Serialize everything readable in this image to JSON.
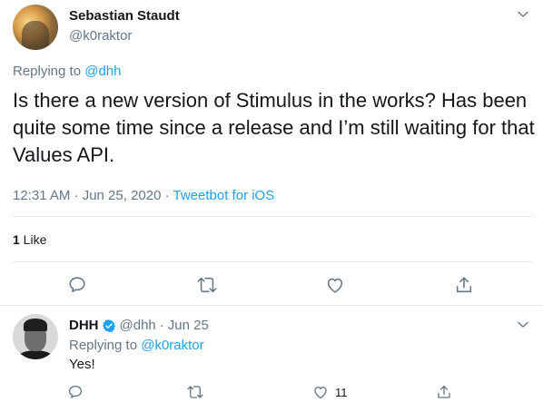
{
  "main_tweet": {
    "author_name": "Sebastian Staudt",
    "author_handle": "@k0raktor",
    "replying_prefix": "Replying to ",
    "replying_to": "@dhh",
    "text": "Is there a new version of Stimulus in the works? Has been quite some time since a release and I’m still waiting for that Values API.",
    "timestamp": "12:31 AM · Jun 25, 2020 · ",
    "source": "Tweetbot for iOS",
    "likes_count": "1",
    "likes_label": " Like",
    "icons": {
      "reply": "comment-icon",
      "retweet": "retweet-icon",
      "like": "heart-icon",
      "share": "share-icon",
      "menu": "chevron-down-icon"
    }
  },
  "reply_tweet": {
    "author_name": "DHH",
    "author_handle": "@dhh",
    "separator": "·",
    "date": "Jun 25",
    "replying_prefix": "Replying to ",
    "replying_to": "@k0raktor",
    "text": "Yes!",
    "like_count": "11",
    "icons": {
      "verified": "verified-badge-icon",
      "reply": "comment-icon",
      "retweet": "retweet-icon",
      "like": "heart-icon",
      "share": "share-icon",
      "menu": "chevron-down-icon"
    }
  },
  "colors": {
    "text": "#14171a",
    "secondary": "#657786",
    "accent": "#1da1f2",
    "border": "#e1e8ed"
  }
}
